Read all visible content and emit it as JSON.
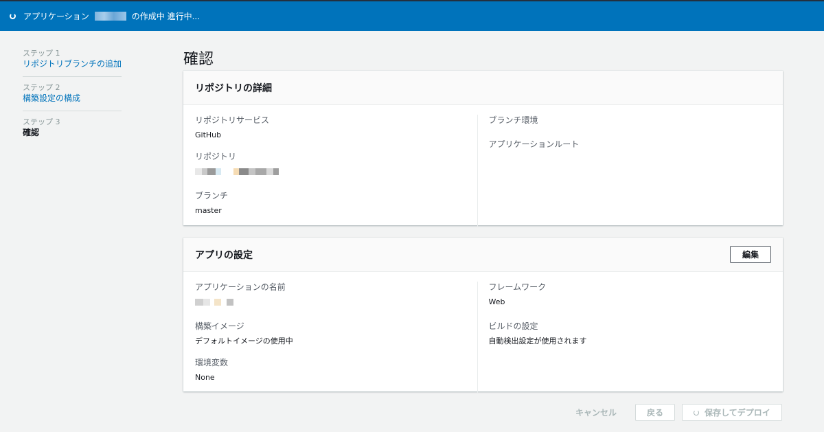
{
  "banner": {
    "prefix": "アプリケーション",
    "suffix": "の作成中 進行中..."
  },
  "nav": {
    "steps": [
      {
        "num": "ステップ 1",
        "label": "リポジトリブランチの追加"
      },
      {
        "num": "ステップ 2",
        "label": "構築設定の構成"
      },
      {
        "num": "ステップ 3",
        "label": "確認"
      }
    ]
  },
  "page": {
    "title": "確認"
  },
  "repo_card": {
    "title": "リポジトリの詳細",
    "service_label": "リポジトリサービス",
    "service_value": "GitHub",
    "repo_label": "リポジトリ",
    "branch_label": "ブランチ",
    "branch_value": "master",
    "branch_env_label": "ブランチ環境",
    "app_root_label": "アプリケーションルート"
  },
  "app_card": {
    "title": "アプリの設定",
    "edit_label": "編集",
    "app_name_label": "アプリケーションの名前",
    "build_image_label": "構築イメージ",
    "build_image_value": "デフォルトイメージの使用中",
    "env_vars_label": "環境変数",
    "env_vars_value": "None",
    "framework_label": "フレームワーク",
    "framework_value": "Web",
    "build_settings_label": "ビルドの設定",
    "build_settings_value": "自動検出設定が使用されます"
  },
  "footer": {
    "cancel_label": "キャンセル",
    "back_label": "戻る",
    "deploy_label": "保存してデプロイ"
  },
  "colors": {
    "banner": "#0073bb",
    "link": "#0073bb",
    "background": "#f2f3f3"
  }
}
